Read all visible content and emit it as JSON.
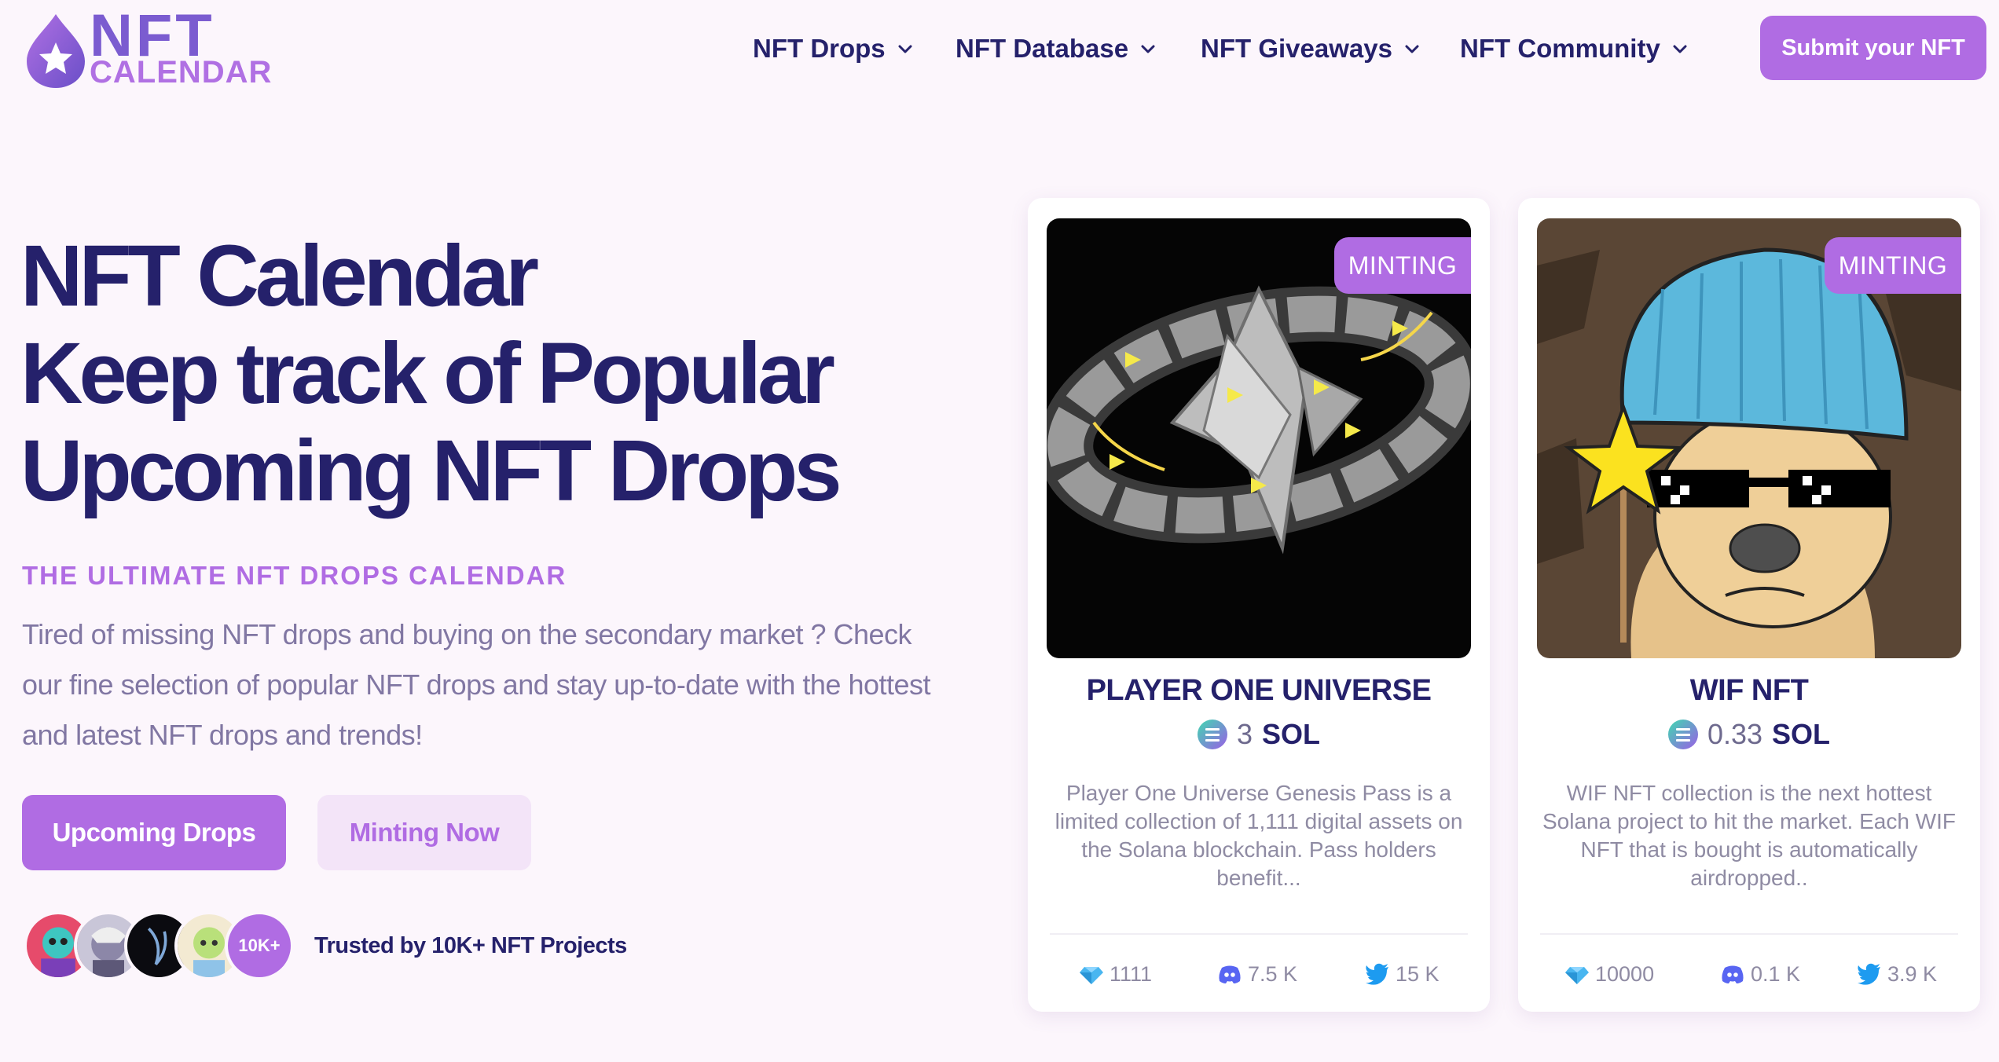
{
  "brand": {
    "logo_top": "NFT",
    "logo_bottom": "CALENDAR",
    "primary_color": "#b06ce3",
    "navy": "#25216b"
  },
  "nav": {
    "items": [
      {
        "label": "NFT Drops",
        "icon": "chevron-down-icon"
      },
      {
        "label": "NFT Database",
        "icon": "chevron-down-icon"
      },
      {
        "label": "NFT Giveaways",
        "icon": "chevron-down-icon"
      },
      {
        "label": "NFT Community",
        "icon": "chevron-down-icon"
      }
    ],
    "submit_label": "Submit your NFT"
  },
  "hero": {
    "title_lines": [
      "NFT Calendar",
      "Keep track of Popular",
      "Upcoming NFT Drops"
    ],
    "eyebrow": "THE ULTIMATE NFT DROPS CALENDAR",
    "description": "Tired of missing NFT drops and buying on the secondary market ? Check our fine selection of popular NFT drops and stay up-to-date with the hottest and latest NFT drops and trends!",
    "primary_button": "Upcoming Drops",
    "secondary_button": "Minting Now"
  },
  "trust": {
    "count_badge": "10K+",
    "text": "Trusted by 10K+ NFT Projects"
  },
  "cards": [
    {
      "badge": "MINTING",
      "title": "PLAYER ONE UNIVERSE",
      "price": "3",
      "currency": "SOL",
      "description": "Player One Universe Genesis Pass is a limited collection of 1,111 digital assets on the Solana blockchain. Pass holders benefit...",
      "stats": {
        "supply": "1111",
        "discord": "7.5 K",
        "twitter": "15 K"
      }
    },
    {
      "badge": "MINTING",
      "title": "WIF NFT",
      "price": "0.33",
      "currency": "SOL",
      "description": "WIF NFT collection is the next hottest Solana project to hit the market. Each WIF NFT that is bought is automatically airdropped..",
      "stats": {
        "supply": "10000",
        "discord": "0.1 K",
        "twitter": "3.9 K"
      }
    }
  ]
}
